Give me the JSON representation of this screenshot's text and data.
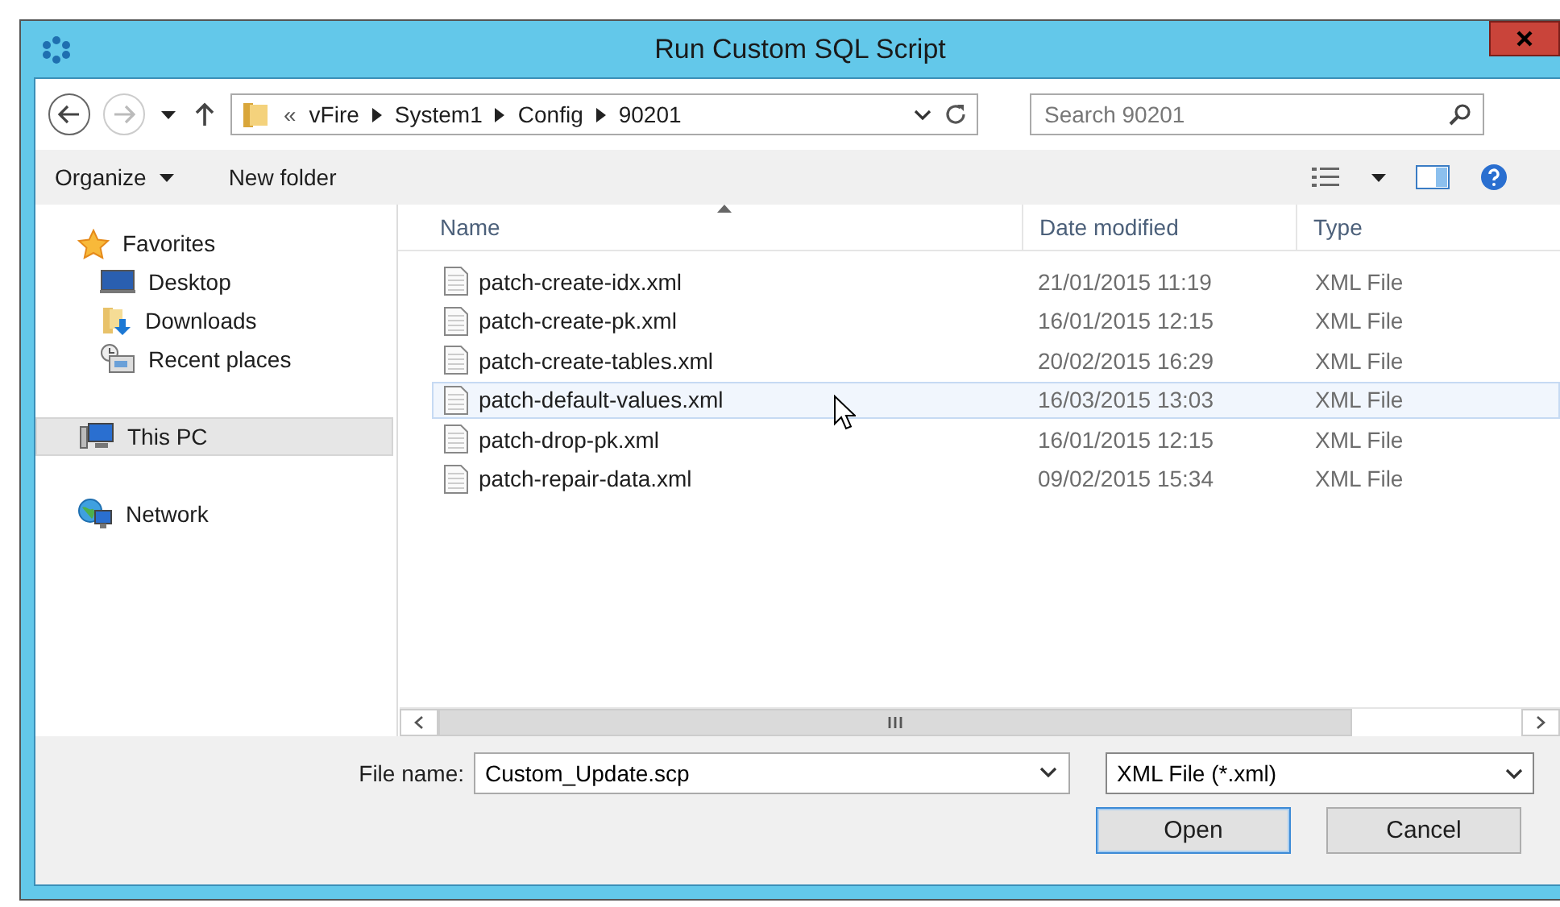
{
  "window": {
    "title": "Run Custom SQL Script"
  },
  "address_bar": {
    "overflow": "«",
    "path": [
      "vFire",
      "System1",
      "Config",
      "90201"
    ]
  },
  "search": {
    "placeholder": "Search 90201"
  },
  "toolbar": {
    "organize": "Organize",
    "new_folder": "New folder"
  },
  "sidebar": {
    "items": [
      {
        "label": "Favorites",
        "kind": "star",
        "selected": false,
        "children": [
          {
            "label": "Desktop",
            "kind": "desktop",
            "selected": false
          },
          {
            "label": "Downloads",
            "kind": "downloads",
            "selected": false
          },
          {
            "label": "Recent places",
            "kind": "recent",
            "selected": false
          }
        ]
      },
      {
        "label": "This PC",
        "kind": "pc",
        "selected": true
      },
      {
        "label": "Network",
        "kind": "network",
        "selected": false
      }
    ]
  },
  "table": {
    "columns": [
      "Name",
      "Date modified",
      "Type"
    ],
    "rows": [
      {
        "name": "patch-create-idx.xml",
        "date": "21/01/2015 11:19",
        "type": "XML File",
        "selected": false
      },
      {
        "name": "patch-create-pk.xml",
        "date": "16/01/2015 12:15",
        "type": "XML File",
        "selected": false
      },
      {
        "name": "patch-create-tables.xml",
        "date": "20/02/2015 16:29",
        "type": "XML File",
        "selected": false
      },
      {
        "name": "patch-default-values.xml",
        "date": "16/03/2015 13:03",
        "type": "XML File",
        "selected": true
      },
      {
        "name": "patch-drop-pk.xml",
        "date": "16/01/2015 12:15",
        "type": "XML File",
        "selected": false
      },
      {
        "name": "patch-repair-data.xml",
        "date": "09/02/2015 15:34",
        "type": "XML File",
        "selected": false
      }
    ]
  },
  "file_name": {
    "label": "File name:",
    "value": "Custom_Update.scp"
  },
  "file_type": {
    "value": "XML File (*.xml)"
  },
  "buttons": [
    {
      "label": "Open",
      "default": true
    },
    {
      "label": "Cancel",
      "default": false
    }
  ]
}
